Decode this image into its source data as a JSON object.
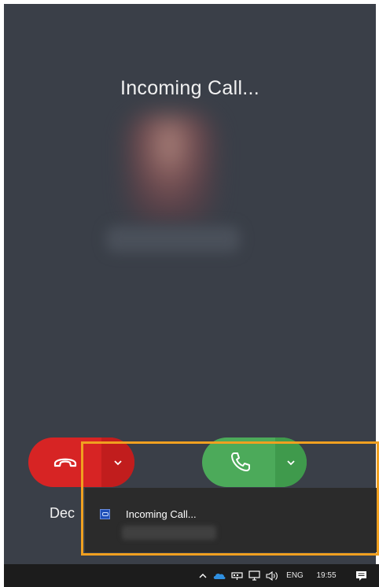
{
  "call": {
    "status_text": "Incoming Call...",
    "decline_label": "Dec"
  },
  "icons": {
    "decline": "phone-hangup-icon",
    "accept": "phone-icon",
    "decline_options": "chevron-down-icon",
    "accept_options": "chevron-down-icon"
  },
  "notification": {
    "title": "Incoming Call...",
    "app_icon": "app-icon"
  },
  "taskbar": {
    "language": "ENG",
    "time": "19:55"
  },
  "colors": {
    "background": "#3a3f48",
    "decline": "#d72424",
    "accept": "#4caa5a",
    "highlight": "#f0a020",
    "toast": "#2b2b2b",
    "taskbar": "#1c1c1c"
  }
}
